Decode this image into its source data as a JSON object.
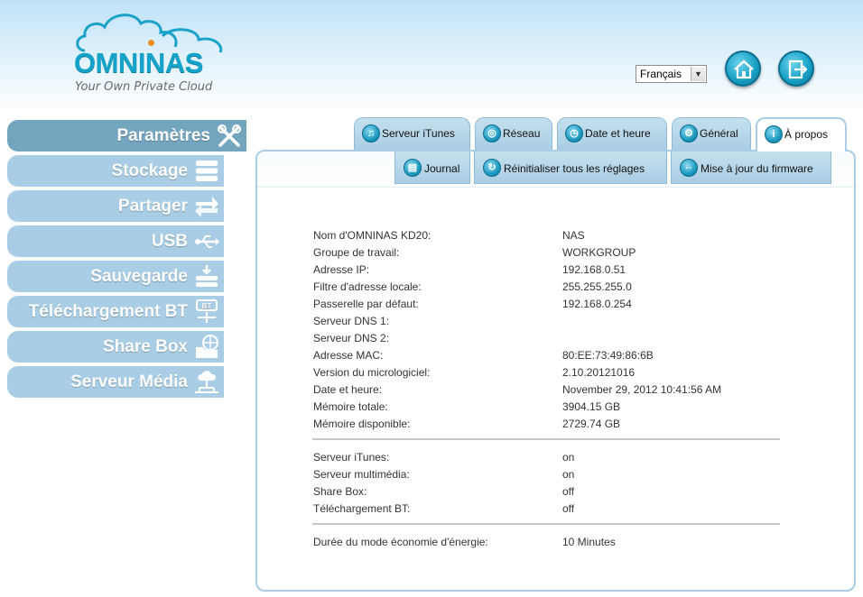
{
  "header": {
    "logo_text": "OMNINAS",
    "tagline": "Your Own Private Cloud",
    "language_selected": "Français",
    "home_icon": "home-icon",
    "logout_icon": "logout-icon"
  },
  "sidebar": {
    "items": [
      {
        "label": "Paramètres",
        "icon": "tools-icon"
      },
      {
        "label": "Stockage",
        "icon": "storage-icon"
      },
      {
        "label": "Partager",
        "icon": "share-arrow-icon"
      },
      {
        "label": "USB",
        "icon": "usb-icon"
      },
      {
        "label": "Sauvegarde",
        "icon": "backup-icon"
      },
      {
        "label": "Téléchargement BT",
        "icon": "bt-download-icon"
      },
      {
        "label": "Share Box",
        "icon": "share-box-icon"
      },
      {
        "label": "Serveur Média",
        "icon": "media-server-icon"
      }
    ]
  },
  "tabs": {
    "main": [
      {
        "label": "Serveur iTunes",
        "icon": "music-note-icon"
      },
      {
        "label": "Réseau",
        "icon": "network-icon"
      },
      {
        "label": "Date et heure",
        "icon": "clock-icon"
      },
      {
        "label": "Général",
        "icon": "gears-icon"
      },
      {
        "label": "À propos",
        "icon": "info-icon"
      }
    ],
    "sub": [
      {
        "label": "Journal",
        "icon": "journal-icon"
      },
      {
        "label": "Réinitialiser tous les réglages",
        "icon": "reset-icon"
      },
      {
        "label": "Mise à jour du firmware",
        "icon": "firmware-update-icon"
      }
    ]
  },
  "about": {
    "system": [
      {
        "label": "Nom d'OMNINAS KD20:",
        "value": "NAS"
      },
      {
        "label": "Groupe de travail:",
        "value": "WORKGROUP"
      },
      {
        "label": "Adresse IP:",
        "value": "192.168.0.51"
      },
      {
        "label": "Filtre d'adresse locale:",
        "value": "255.255.255.0"
      },
      {
        "label": "Passerelle par défaut:",
        "value": "192.168.0.254"
      },
      {
        "label": "Serveur DNS 1:",
        "value": ""
      },
      {
        "label": "Serveur DNS 2:",
        "value": ""
      },
      {
        "label": "Adresse MAC:",
        "value": "80:EE:73:49:86:6B"
      },
      {
        "label": "Version du micrologiciel:",
        "value": "2.10.20121016"
      },
      {
        "label": "Date et heure:",
        "value": "November 29, 2012 10:41:56 AM"
      },
      {
        "label": "Mémoire totale:",
        "value": "3904.15 GB"
      },
      {
        "label": "Mémoire disponible:",
        "value": "2729.74 GB"
      }
    ],
    "services": [
      {
        "label": "Serveur iTunes:",
        "value": "on"
      },
      {
        "label": "Serveur multimédia:",
        "value": "on"
      },
      {
        "label": "Share Box:",
        "value": "off"
      },
      {
        "label": "Téléchargement BT:",
        "value": "off"
      }
    ],
    "power": [
      {
        "label": "Durée du mode économie d'énergie:",
        "value": "10 Minutes"
      }
    ]
  },
  "colors": {
    "accent": "#17a2c9",
    "sidebar": "#a9cde4",
    "sidebar_active": "#74a5be"
  }
}
